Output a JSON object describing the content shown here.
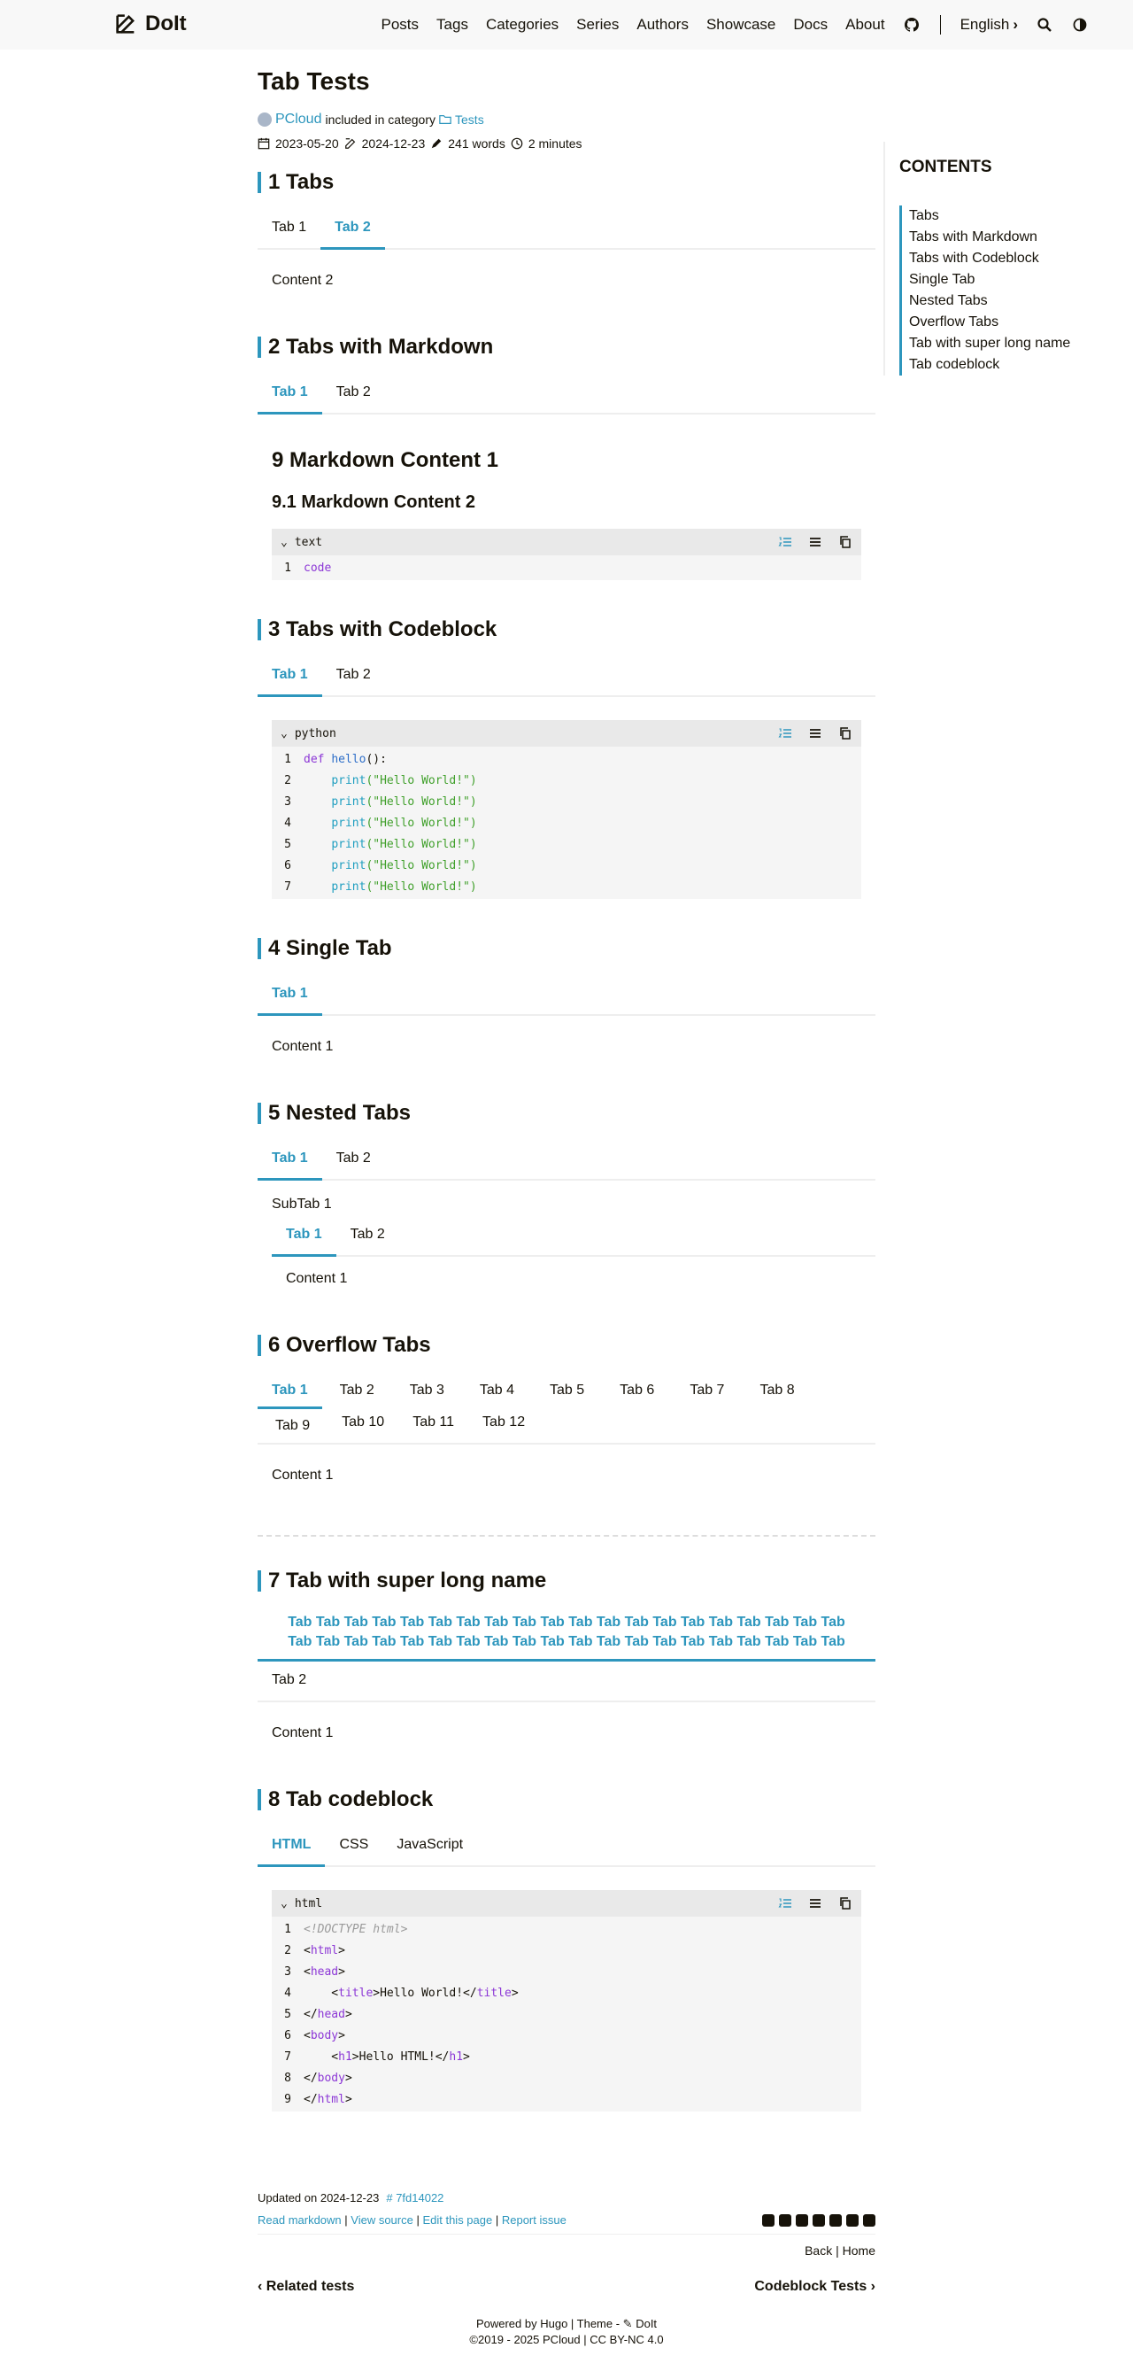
{
  "header": {
    "brand": "DoIt",
    "nav": [
      "Posts",
      "Tags",
      "Categories",
      "Series",
      "Authors",
      "Showcase",
      "Docs",
      "About"
    ],
    "language": "English"
  },
  "post": {
    "title": "Tab Tests",
    "author": "PCloud",
    "included_text": "included in category",
    "category": "Tests",
    "date": "2023-05-20",
    "updated": "2024-12-23",
    "words": "241 words",
    "reading": "2 minutes"
  },
  "toc": {
    "heading": "CONTENTS",
    "items": [
      "Tabs",
      "Tabs with Markdown",
      "Tabs with Codeblock",
      "Single Tab",
      "Nested Tabs",
      "Overflow Tabs",
      "Tab with super long name",
      "Tab codeblock"
    ]
  },
  "sections": {
    "s1": {
      "heading": "1 Tabs",
      "tabs": [
        "Tab 1",
        "Tab 2"
      ],
      "content": "Content 2"
    },
    "s2": {
      "heading": "2 Tabs with Markdown",
      "tabs": [
        "Tab 1",
        "Tab 2"
      ],
      "h_big": "9 Markdown Content 1",
      "h_small": "9.1 Markdown Content 2",
      "code_lang": "text",
      "code": [
        "code"
      ]
    },
    "s3": {
      "heading": "3 Tabs with Codeblock",
      "tabs": [
        "Tab 1",
        "Tab 2"
      ],
      "code_lang": "python"
    },
    "s4": {
      "heading": "4 Single Tab",
      "tabs": [
        "Tab 1"
      ],
      "content": "Content 1"
    },
    "s5": {
      "heading": "5 Nested Tabs",
      "tabs": [
        "Tab 1",
        "Tab 2"
      ],
      "subtab_label": "SubTab 1",
      "subtabs": [
        "Tab 1",
        "Tab 2"
      ],
      "content": "Content 1"
    },
    "s6": {
      "heading": "6 Overflow Tabs",
      "tabs": [
        "Tab 1",
        "Tab 2",
        "Tab 3",
        "Tab 4",
        "Tab 5",
        "Tab 6",
        "Tab 7",
        "Tab 8",
        "Tab 9",
        "Tab 10",
        "Tab 11",
        "Tab 12"
      ],
      "content": "Content 1"
    },
    "s7": {
      "heading": "7 Tab with super long name",
      "long_tab_line1": "Tab Tab Tab Tab Tab Tab Tab Tab Tab Tab Tab Tab Tab Tab Tab Tab Tab Tab Tab Tab",
      "long_tab_line2": "Tab Tab Tab Tab Tab Tab Tab Tab Tab Tab Tab Tab Tab Tab Tab Tab Tab Tab Tab Tab",
      "tab2": "Tab 2",
      "content": "Content 1"
    },
    "s8": {
      "heading": "8 Tab codeblock",
      "tabs": [
        "HTML",
        "CSS",
        "JavaScript"
      ],
      "code_lang": "html"
    }
  },
  "python_code": [
    "def",
    "hello",
    "():",
    "print",
    "(\"Hello World!\")"
  ],
  "html_code": {
    "doctype": "<!DOCTYPE html>",
    "title_text": "Hello World!",
    "h1_text": "Hello HTML!"
  },
  "footer": {
    "updated": "Updated on 2024-12-23",
    "commit": "7fd14022",
    "links": [
      "Read markdown",
      "View source",
      "Edit this page",
      "Report issue"
    ],
    "back": "Back",
    "home": "Home",
    "prev": "Related tests",
    "next": "Codeblock Tests",
    "powered": "Powered by Hugo | Theme - ",
    "theme": "DoIt",
    "copyright": "2019 - 2025 PCloud | CC BY-NC 4.0"
  }
}
